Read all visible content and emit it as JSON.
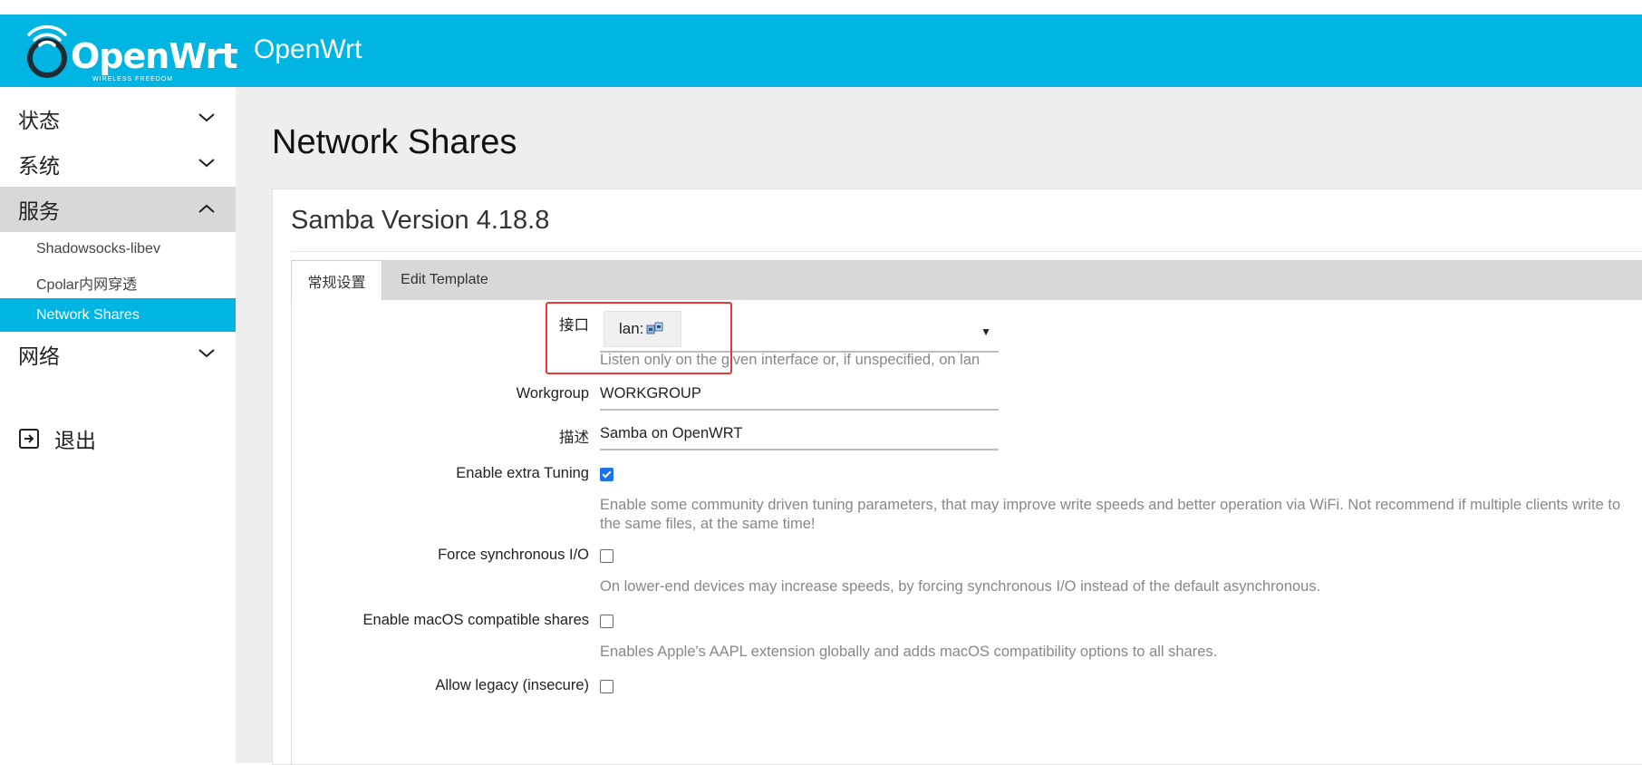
{
  "header": {
    "logo_text": "OpenWrt",
    "logo_subtext": "WIRELESS FREEDOM",
    "title": "OpenWrt"
  },
  "sidebar": {
    "items": [
      {
        "label": "状态",
        "expanded": false
      },
      {
        "label": "系统",
        "expanded": false
      },
      {
        "label": "服务",
        "expanded": true,
        "children": [
          {
            "label": "Shadowsocks-libev",
            "active": false
          },
          {
            "label": "Cpolar内网穿透",
            "active": false
          },
          {
            "label": "Network Shares",
            "active": true
          }
        ]
      },
      {
        "label": "网络",
        "expanded": false
      }
    ],
    "logout": "退出"
  },
  "main": {
    "page_title": "Network Shares",
    "section_title": "Samba Version 4.18.8",
    "tabs": [
      {
        "label": "常规设置",
        "active": true
      },
      {
        "label": "Edit Template",
        "active": false
      }
    ],
    "form": {
      "interface": {
        "label": "接口",
        "value": "lan:",
        "icon": "network-ports-icon",
        "description": "Listen only on the given interface or, if unspecified, on lan"
      },
      "workgroup": {
        "label": "Workgroup",
        "value": "WORKGROUP"
      },
      "description": {
        "label": "描述",
        "value": "Samba on OpenWRT"
      },
      "extra_tuning": {
        "label": "Enable extra Tuning",
        "checked": true,
        "description": "Enable some community driven tuning parameters, that may improve write speeds and better operation via WiFi. Not recommend if multiple clients write to the same files, at the same time!"
      },
      "force_sync": {
        "label": "Force synchronous I/O",
        "checked": false,
        "description": "On lower-end devices may increase speeds, by forcing synchronous I/O instead of the default asynchronous."
      },
      "macos_shares": {
        "label": "Enable macOS compatible shares",
        "checked": false,
        "description": "Enables Apple's AAPL extension globally and adds macOS compatibility options to all shares."
      },
      "allow_legacy": {
        "label": "Allow legacy (insecure)",
        "checked": false
      }
    }
  },
  "colors": {
    "accent": "#00b5e2",
    "highlight": "#e53935",
    "checkbox": "#1a73e8"
  }
}
